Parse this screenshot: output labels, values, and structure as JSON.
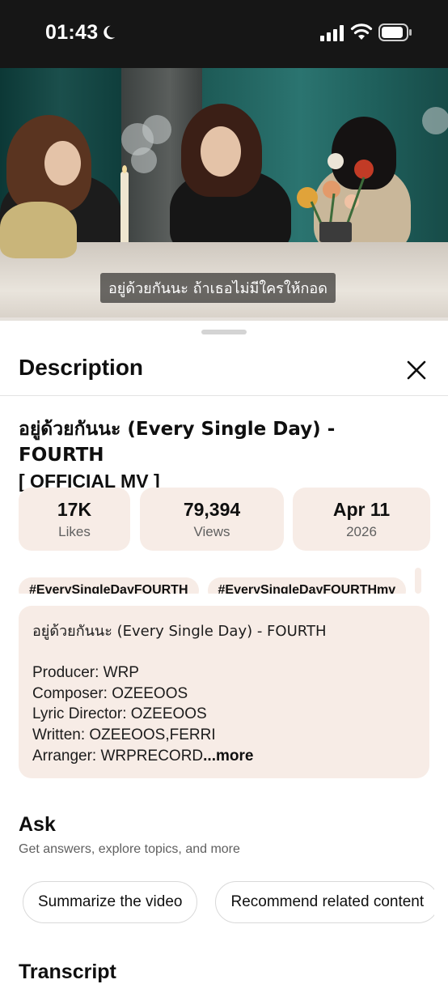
{
  "status_bar": {
    "time": "01:43"
  },
  "video": {
    "subtitle": "อยู่ด้วยกันนะ ถ้าเธอไม่มีใครให้กอด"
  },
  "sheet": {
    "title": "Description"
  },
  "video_title": {
    "line1": "อยู่ด้วยกันนะ (Every Single Day) - FOURTH",
    "line2": "[ OFFICIAL MV ]"
  },
  "stats": [
    {
      "value": "17K",
      "label": "Likes"
    },
    {
      "value": "79,394",
      "label": "Views"
    },
    {
      "value": "Apr 11",
      "label": "2026"
    }
  ],
  "hashtags": [
    "#EverySingleDayFOURTH",
    "#EverySingleDayFOURTHmv"
  ],
  "description": {
    "lines": [
      "อยู่ด้วยกันนะ (Every Single Day) - FOURTH",
      "",
      "Producer: WRP",
      "Composer: OZEEOOS",
      "Lyric Director: OZEEOOS",
      "Written: OZEEOOS,FERRI"
    ],
    "last_line": "Arranger: WRPRECORD",
    "more_label": "...more"
  },
  "ask": {
    "title": "Ask",
    "subtitle": "Get answers, explore topics, and more",
    "chips": [
      "Summarize the video",
      "Recommend related content"
    ]
  },
  "transcript": {
    "title": "Transcript"
  },
  "colors": {
    "chip_bg": "#f7ece6",
    "status_bg": "#161616"
  },
  "icons": [
    "moon-icon",
    "cellular-signal-icon",
    "wifi-icon",
    "battery-icon",
    "close-icon"
  ]
}
